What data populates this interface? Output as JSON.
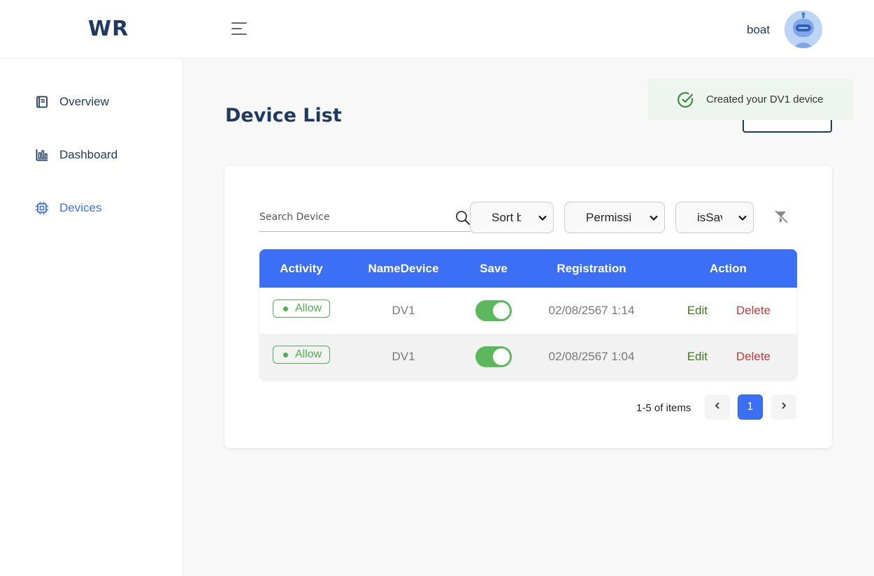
{
  "app": {
    "logo": "WR"
  },
  "header": {
    "username": "boat",
    "avatar_icon": "robot-avatar-icon"
  },
  "sidebar": {
    "items": [
      {
        "label": "Overview",
        "icon": "overview-icon",
        "active": false
      },
      {
        "label": "Dashboard",
        "icon": "dashboard-icon",
        "active": false
      },
      {
        "label": "Devices",
        "icon": "devices-icon",
        "active": true
      }
    ]
  },
  "page": {
    "title": "Device List"
  },
  "toast": {
    "message": "Created your DV1 device",
    "icon": "check-circle-icon"
  },
  "filters": {
    "search_placeholder": "Search Device",
    "sort_label": "Sort by",
    "permission_label": "Permission",
    "issave_label": "isSave"
  },
  "table": {
    "headers": [
      "Activity",
      "NameDevice",
      "Save",
      "Registration",
      "Action"
    ],
    "rows": [
      {
        "activity": "Allow",
        "name": "DV1",
        "save": true,
        "registration": "02/08/2567 1:14",
        "edit": "Edit",
        "delete": "Delete"
      },
      {
        "activity": "Allow",
        "name": "DV1",
        "save": true,
        "registration": "02/08/2567 1:04",
        "edit": "Edit",
        "delete": "Delete"
      }
    ]
  },
  "pagination": {
    "summary": "1-5 of items",
    "current_page": "1"
  },
  "colors": {
    "primary": "#3b6ff5",
    "navy": "#1e3a5f",
    "success": "#4caf50",
    "danger": "#c0393b",
    "edit": "#3d7a1f"
  }
}
